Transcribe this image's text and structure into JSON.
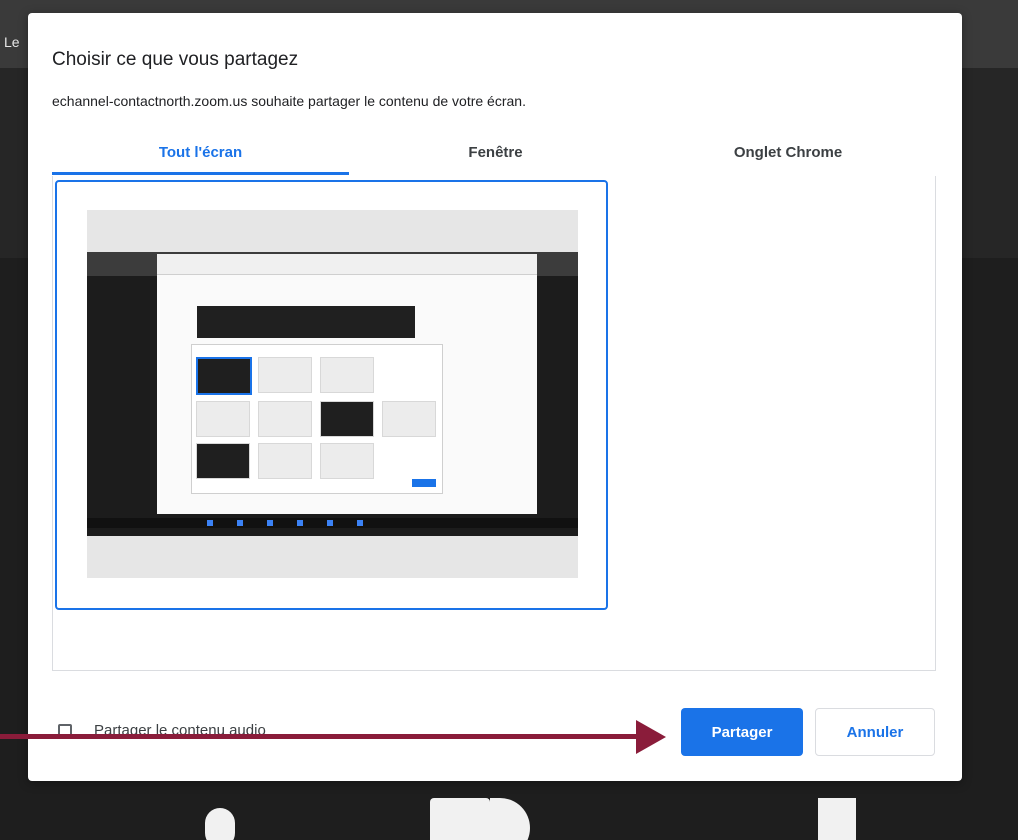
{
  "background": {
    "left_text": "Le"
  },
  "dialog": {
    "title": "Choisir ce que vous partagez",
    "subtitle": "echannel-contactnorth.zoom.us souhaite partager le contenu de votre écran.",
    "tabs": [
      {
        "label": "Tout l'écran",
        "active": true
      },
      {
        "label": "Fenêtre",
        "active": false
      },
      {
        "label": "Onglet Chrome",
        "active": false
      }
    ],
    "audio_option": {
      "label": "Partager le contenu audio",
      "checked": false
    },
    "buttons": {
      "share": "Partager",
      "cancel": "Annuler"
    }
  },
  "colors": {
    "accent": "#1a73e8",
    "annotation_arrow": "#8a1c3a"
  }
}
